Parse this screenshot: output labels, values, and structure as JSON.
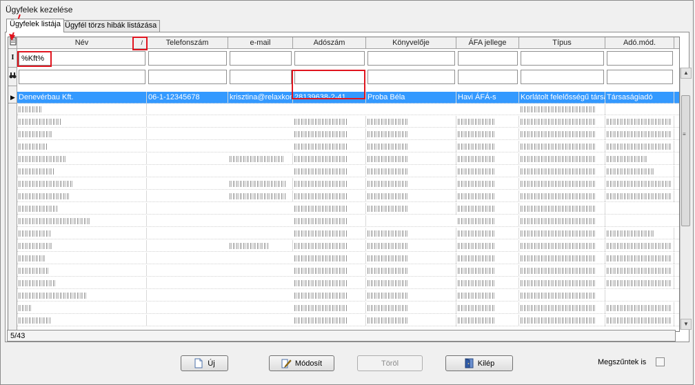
{
  "window": {
    "title": "Ügyfelek kezelése"
  },
  "tabs": [
    {
      "label": "Ügyfelek listája",
      "active": true
    },
    {
      "label": "Ügyfél törzs hibák listázása",
      "active": false
    }
  ],
  "grid": {
    "columns": [
      "Név",
      "Telefonszám",
      "e-mail",
      "Adószám",
      "Könyvelője",
      "ÁFA jellege",
      "Típus",
      "Adó.mód."
    ],
    "sort_indicator": "/",
    "row_indicators": {
      "filter": "I",
      "search": "👓",
      "current": "▶"
    },
    "filter_values": [
      "%Kft%",
      "",
      "",
      "",
      "",
      "",
      "",
      ""
    ],
    "search_values": [
      "",
      "",
      "",
      "",
      "",
      "",
      "",
      ""
    ],
    "selected_row": [
      "Denevérbau Kft.",
      "06-1-12345678",
      "krisztina@relaxkon",
      "28139638-2-41",
      "Proba Béla",
      "Havi ÁFÁ-s",
      "Korlátolt felelősségű társa",
      "Társaságiadó"
    ]
  },
  "status": {
    "record_position": "5/43"
  },
  "buttons": {
    "new": "Új",
    "modify": "Módosít",
    "delete": "Töröl",
    "exit": "Kilép"
  },
  "options": {
    "show_terminated_label": "Megszűntek is",
    "show_terminated": false
  },
  "colors": {
    "selection": "#3399ff",
    "highlight": "#e0141e"
  }
}
